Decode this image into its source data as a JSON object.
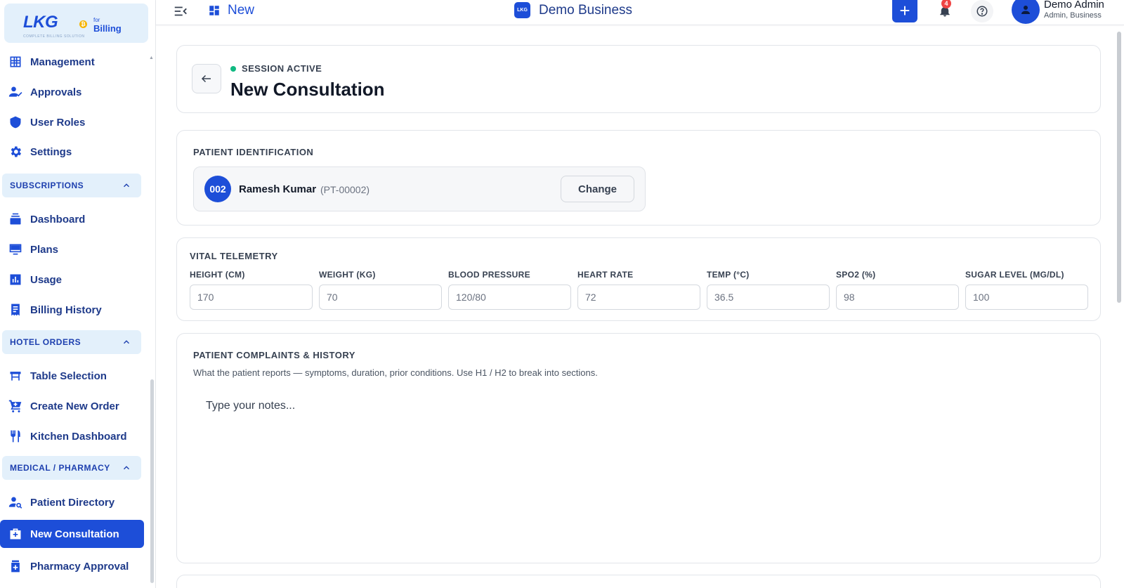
{
  "brand": {
    "logo": "LKG",
    "coin": "₿",
    "for": "for",
    "billing": "Billing",
    "tagline": "COMPLETE BILLING SOLUTION"
  },
  "sidebar": {
    "items_top": [
      {
        "label": "Management",
        "icon": "grid-table-icon"
      },
      {
        "label": "Approvals",
        "icon": "user-check-icon"
      },
      {
        "label": "User Roles",
        "icon": "shield-user-icon"
      },
      {
        "label": "Settings",
        "icon": "gear-icon"
      }
    ],
    "sections": [
      {
        "label": "SUBSCRIPTIONS"
      },
      {
        "label": "HOTEL ORDERS"
      },
      {
        "label": "MEDICAL / PHARMACY"
      }
    ],
    "subscriptions": [
      {
        "label": "Dashboard",
        "icon": "stack-icon"
      },
      {
        "label": "Plans",
        "icon": "monitor-icon"
      },
      {
        "label": "Usage",
        "icon": "bar-chart-icon"
      },
      {
        "label": "Billing History",
        "icon": "receipt-icon"
      }
    ],
    "hotel_orders": [
      {
        "label": "Table Selection",
        "icon": "table-icon"
      },
      {
        "label": "Create New Order",
        "icon": "cart-plus-icon"
      },
      {
        "label": "Kitchen Dashboard",
        "icon": "utensils-icon"
      }
    ],
    "medical": [
      {
        "label": "Patient Directory",
        "icon": "user-search-icon"
      },
      {
        "label": "New Consultation",
        "icon": "medical-bag-icon",
        "active": true
      },
      {
        "label": "Pharmacy Approval",
        "icon": "pill-bottle-icon"
      }
    ]
  },
  "topbar": {
    "new_label": "New",
    "business_name": "Demo Business",
    "business_logo": "LKG",
    "plus": "+",
    "notification_count": "4",
    "user_name": "Demo Admin",
    "user_role": "Admin, Business"
  },
  "header": {
    "session_status": "SESSION ACTIVE",
    "title": "New Consultation"
  },
  "patient": {
    "section_label": "PATIENT IDENTIFICATION",
    "number": "002",
    "name": "Ramesh Kumar",
    "code": "(PT-00002)",
    "change_label": "Change"
  },
  "vitals": {
    "section_label": "VITAL TELEMETRY",
    "fields": [
      {
        "label": "HEIGHT (CM)",
        "placeholder": "170"
      },
      {
        "label": "WEIGHT (KG)",
        "placeholder": "70"
      },
      {
        "label": "BLOOD PRESSURE",
        "placeholder": "120/80"
      },
      {
        "label": "HEART RATE",
        "placeholder": "72"
      },
      {
        "label": "TEMP (°C)",
        "placeholder": "36.5"
      },
      {
        "label": "SPO2 (%)",
        "placeholder": "98"
      },
      {
        "label": "SUGAR LEVEL (MG/DL)",
        "placeholder": "100"
      }
    ]
  },
  "complaints": {
    "section_label": "PATIENT COMPLAINTS & HISTORY",
    "subtitle": "What the patient reports — symptoms, duration, prior conditions. Use H1 / H2 to break into sections.",
    "placeholder": "Type your notes..."
  },
  "colors": {
    "accent": "#1d4ed8",
    "active_dot": "#10b981",
    "badge": "#ef4444"
  }
}
